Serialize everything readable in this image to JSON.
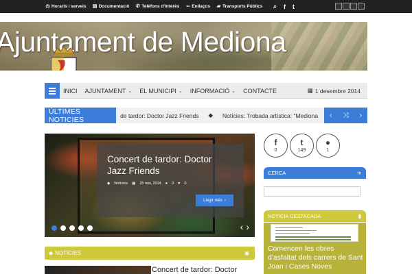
{
  "topbar": {
    "links": [
      {
        "icon": "clock-icon",
        "glyph": "◷",
        "label": "Horaris i serveis"
      },
      {
        "icon": "document-icon",
        "glyph": "▤",
        "label": "Documentació"
      },
      {
        "icon": "phone-icon",
        "glyph": "✆",
        "label": "Telèfons d'Interès"
      },
      {
        "icon": "link-icon",
        "glyph": "∞",
        "label": "Enllaços"
      },
      {
        "icon": "truck-icon",
        "glyph": "▰",
        "label": "Transports Públics"
      }
    ],
    "social": {
      "search": "⌕",
      "facebook": "f",
      "twitter": "t"
    }
  },
  "header": {
    "title": "Ajuntament de Mediona"
  },
  "nav": {
    "items": [
      {
        "label": "INICI",
        "dropdown": false
      },
      {
        "label": "AJUNTAMENT",
        "dropdown": true
      },
      {
        "label": "EL MUNICIPI",
        "dropdown": true
      },
      {
        "label": "INFORMACIÓ",
        "dropdown": true
      },
      {
        "label": "CONTACTE",
        "dropdown": false
      }
    ],
    "date": "1 desembre 2014"
  },
  "ticker": {
    "label": "ÚLTIMES NOTICIES",
    "items": [
      "Concert de tardor: Doctor Jazz Friends",
      "Notícies: Trobada artística: \"Mediona"
    ]
  },
  "slider": {
    "title": "Concert de tardor: Doctor Jazz Friends",
    "category": "Notícies",
    "date": "25 nov, 2014",
    "comments": "0",
    "likes": "0",
    "more_label": "Llegir més",
    "dots": 5
  },
  "section": {
    "title": "NOTÍCIES"
  },
  "post": {
    "title": "Concert de tardor: Doctor"
  },
  "sidebar": {
    "counters": [
      {
        "icon": "facebook-icon",
        "glyph": "f",
        "value": "0"
      },
      {
        "icon": "twitter-icon",
        "glyph": "t",
        "value": "149"
      },
      {
        "icon": "comment-icon",
        "glyph": "●",
        "value": "1"
      }
    ],
    "search_title": "CERCA",
    "featured_title": "NOTÍCIA DESTACADA",
    "featured_post": "Comencen les obres d'asfaltat dels carrers de Sant Joan i Cases Noves"
  },
  "colors": {
    "accent_blue": "#3b7dd8",
    "accent_olive": "#cdc93a",
    "topbar": "#222222"
  }
}
